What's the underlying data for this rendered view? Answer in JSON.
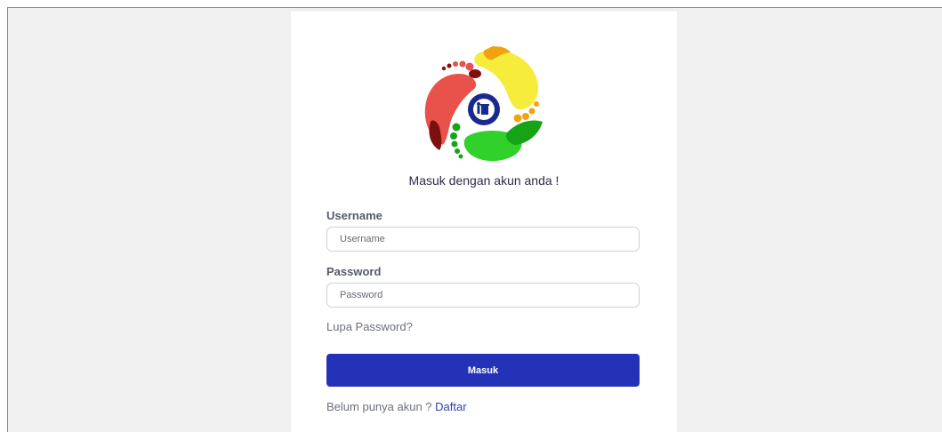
{
  "login": {
    "subtitle": "Masuk dengan akun anda !",
    "username_label": "Username",
    "username_placeholder": "Username",
    "username_value": "",
    "password_label": "Password",
    "password_placeholder": "Password",
    "password_value": "",
    "forgot_link": "Lupa Password?",
    "submit_label": "Masuk",
    "register_prompt": "Belum punya akun ? ",
    "register_link": "Daftar"
  },
  "logo": {
    "icon": "recycle-footprints-trash-icon",
    "colors": {
      "red": "#e8524a",
      "darkred": "#7d0f0f",
      "orange": "#f2a20c",
      "yellow": "#f6ec3c",
      "green": "#2fd12a",
      "darkgreen": "#16a316",
      "navy": "#1a2a8c"
    }
  },
  "theme": {
    "primary": "#2432b8",
    "background": "#f0f0f0",
    "card": "#ffffff"
  }
}
